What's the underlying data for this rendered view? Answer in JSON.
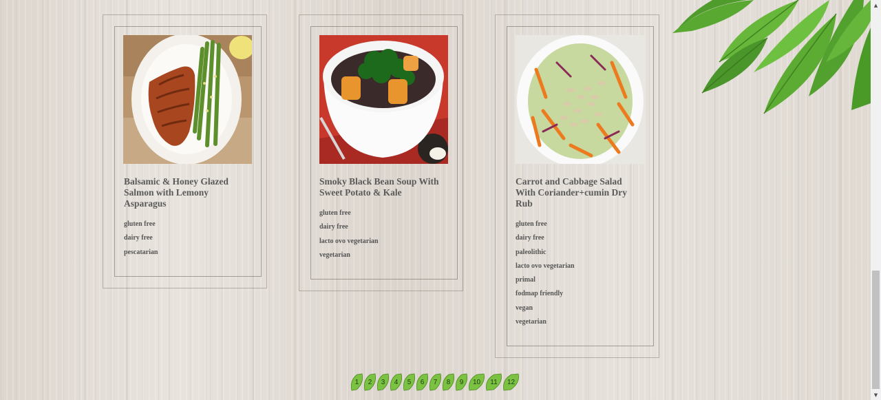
{
  "recipes": [
    {
      "title": "Balsamic & Honey Glazed Salmon with Lemony Asparagus",
      "image_icon": "salmon-asparagus-photo",
      "tags": [
        "gluten free",
        "dairy free",
        "pescatarian"
      ]
    },
    {
      "title": "Smoky Black Bean Soup With Sweet Potato & Kale",
      "image_icon": "black-bean-soup-photo",
      "tags": [
        "gluten free",
        "dairy free",
        "lacto ovo vegetarian",
        "vegetarian"
      ]
    },
    {
      "title": "Carrot and Cabbage Salad With Coriander+cumin Dry Rub",
      "image_icon": "carrot-cabbage-salad-photo",
      "tags": [
        "gluten free",
        "dairy free",
        "paleolithic",
        "lacto ovo vegetarian",
        "primal",
        "fodmap friendly",
        "vegan",
        "vegetarian"
      ]
    }
  ],
  "pagination": {
    "pages": [
      "1",
      "2",
      "3",
      "4",
      "5",
      "6",
      "7",
      "8",
      "9",
      "10",
      "11",
      "12"
    ],
    "icon": "leaf-icon",
    "color": "#7cc242"
  },
  "decoration": {
    "icon": "green-leaves-icon",
    "color": "#5aa832"
  },
  "scrollbar": {
    "up_icon": "scroll-up-arrow-icon",
    "down_icon": "scroll-down-arrow-icon"
  }
}
